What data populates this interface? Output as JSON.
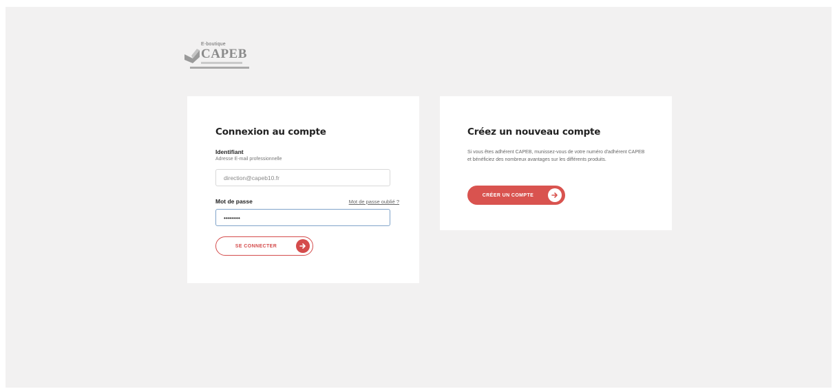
{
  "logo": {
    "top_text": "E-boutique",
    "brand": "CAPEB"
  },
  "login": {
    "title": "Connexion au compte",
    "identifier_label": "Identifiant",
    "identifier_hint": "Adresse E-mail professionnelle",
    "identifier_value": "direction@capeb10.fr",
    "password_label": "Mot de passe",
    "password_value": "••••••••",
    "forgot_link": "Mot de passe oublié ?",
    "submit_label": "SE CONNECTER",
    "submit_icon": "arrow-right-icon"
  },
  "create": {
    "title": "Créez un nouveau compte",
    "description": "Si vous êtes adhérent CAPEB, munissez-vous de votre numéro d'adhérent CAPEB et bénéficiez des nombreux avantages sur les différents produits.",
    "button_label": "CRÉER UN COMPTE",
    "button_icon": "arrow-right-icon"
  },
  "colors": {
    "accent": "#d9534f",
    "page_bg": "#f2f1f1",
    "card_bg": "#ffffff",
    "focus_border": "#7ea3c9"
  }
}
